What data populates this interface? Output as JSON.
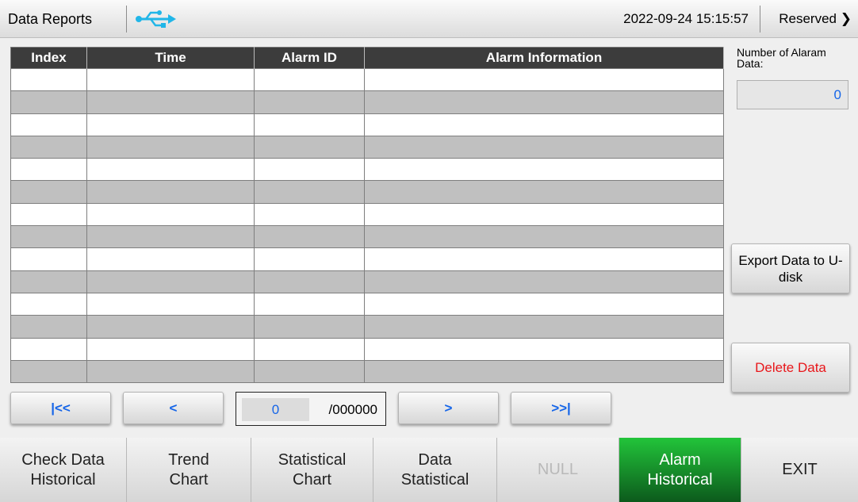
{
  "header": {
    "title": "Data Reports",
    "datetime": "2022-09-24 15:15:57",
    "reserved_label": "Reserved",
    "usb_icon": "usb-icon",
    "usb_color": "#21b6e8"
  },
  "table": {
    "columns": [
      "Index",
      "Time",
      "Alarm ID",
      "Alarm Information"
    ],
    "row_count": 14
  },
  "side_panel": {
    "count_label": "Number of Alaram Data:",
    "count_value": "0",
    "export_label": "Export Data to U-disk",
    "delete_label": "Delete Data",
    "delete_color": "#e8161a"
  },
  "pager": {
    "first_label": "|<<",
    "prev_label": "<",
    "next_label": ">",
    "last_label": ">>|",
    "current_page": "0",
    "total_pages": "/000000"
  },
  "bottom_nav": [
    {
      "label": "Check Data\nHistorical",
      "state": "normal"
    },
    {
      "label": "Trend\nChart",
      "state": "normal"
    },
    {
      "label": "Statistical\nChart",
      "state": "normal"
    },
    {
      "label": "Data\nStatistical",
      "state": "normal"
    },
    {
      "label": "NULL",
      "state": "disabled"
    },
    {
      "label": "Alarm\nHistorical",
      "state": "active"
    },
    {
      "label": "EXIT",
      "state": "normal"
    }
  ],
  "colors": {
    "accent_blue": "#1565e8",
    "active_green": "#1aa62f",
    "table_header": "#3c3c3c"
  }
}
